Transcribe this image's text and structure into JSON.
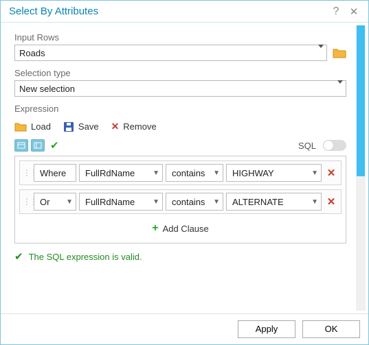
{
  "dialog": {
    "title": "Select By Attributes"
  },
  "input_rows": {
    "label": "Input Rows",
    "value": "Roads"
  },
  "selection_type": {
    "label": "Selection type",
    "value": "New selection"
  },
  "expression": {
    "label": "Expression",
    "load_label": "Load",
    "save_label": "Save",
    "remove_label": "Remove",
    "sql_label": "SQL",
    "sql_enabled": false,
    "valid_message": "The SQL expression is valid.",
    "add_clause_label": "Add Clause",
    "clauses": [
      {
        "conj": "Where",
        "field": "FullRdName",
        "operator": "contains",
        "value": "HIGHWAY"
      },
      {
        "conj": "Or",
        "field": "FullRdName",
        "operator": "contains",
        "value": "ALTERNATE"
      }
    ]
  },
  "footer": {
    "apply": "Apply",
    "ok": "OK"
  }
}
